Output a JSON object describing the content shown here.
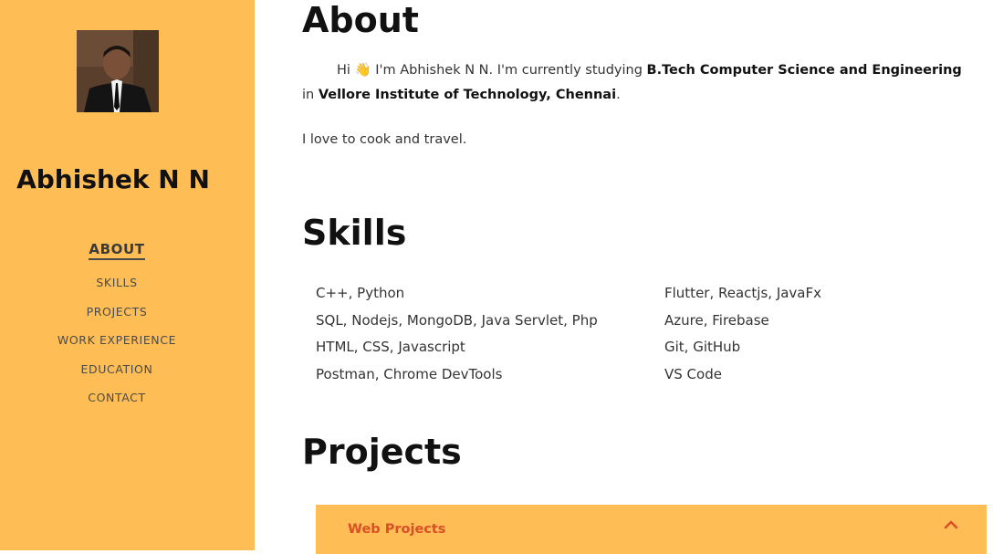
{
  "sidebar": {
    "name": "Abhishek N N",
    "avatar_icon": "profile-photo",
    "background_color": "#ffbe55",
    "nav": [
      {
        "label": "ABOUT",
        "active": true
      },
      {
        "label": "SKILLS",
        "active": false
      },
      {
        "label": "PROJECTS",
        "active": false
      },
      {
        "label": "WORK EXPERIENCE",
        "active": false
      },
      {
        "label": "EDUCATION",
        "active": false
      },
      {
        "label": "CONTACT",
        "active": false
      }
    ]
  },
  "about": {
    "heading": "About",
    "intro_hi": "Hi",
    "intro_emoji": "👋",
    "intro_text": " I'm Abhishek N N. I'm currently studying ",
    "degree": "B.Tech Computer Science and Engineering",
    "in_text": " in ",
    "college": "Vellore Institute of Technology, Chennai",
    "end": ".",
    "hobbies": "I love to cook and travel."
  },
  "skills": {
    "heading": "Skills",
    "left": [
      "C++, Python",
      "SQL, Nodejs, MongoDB, Java Servlet, Php",
      "HTML, CSS, Javascript",
      "Postman, Chrome DevTools"
    ],
    "right": [
      "Flutter, Reactjs, JavaFx",
      "Azure, Firebase",
      "Git, GitHub",
      "VS Code"
    ]
  },
  "projects": {
    "heading": "Projects",
    "accordion_label": "Web Projects",
    "accordion_icon": "chevron-up-icon",
    "accent_color": "#d94f27"
  }
}
